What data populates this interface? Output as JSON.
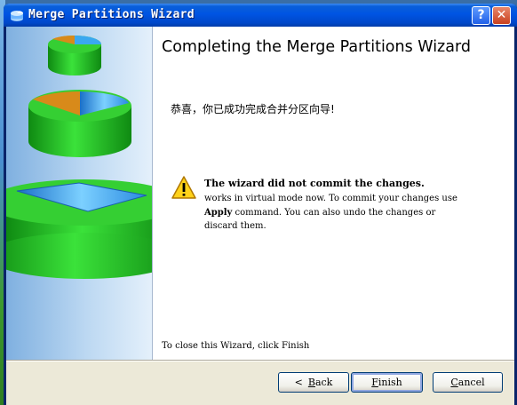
{
  "window": {
    "title": "Merge Partitions Wizard",
    "help_glyph": "?",
    "close_glyph": "✕"
  },
  "page": {
    "heading": "Completing the Merge Partitions Wizard",
    "congrats": "恭喜，你已成功完成合并分区向导!",
    "warning": {
      "icon": "warning-icon",
      "title": "The wizard did not commit the changes.",
      "line1": "works in virtual mode now. To commit your changes use",
      "line2_bold": "Apply",
      "line2_rest": " command. You can also undo the changes or",
      "line3": "discard them."
    },
    "close_hint": "To close this Wizard, click Finish"
  },
  "buttons": {
    "back": {
      "arrow": "<",
      "accel": "B",
      "rest": "ack"
    },
    "finish": {
      "accel": "F",
      "rest": "inish"
    },
    "cancel": {
      "accel": "C",
      "rest": "ancel"
    }
  },
  "colors": {
    "titlebar": "#0054e3",
    "disk_green": "#22c41c",
    "disk_blue": "#3aa8f0",
    "disk_orange": "#d88a1a"
  }
}
